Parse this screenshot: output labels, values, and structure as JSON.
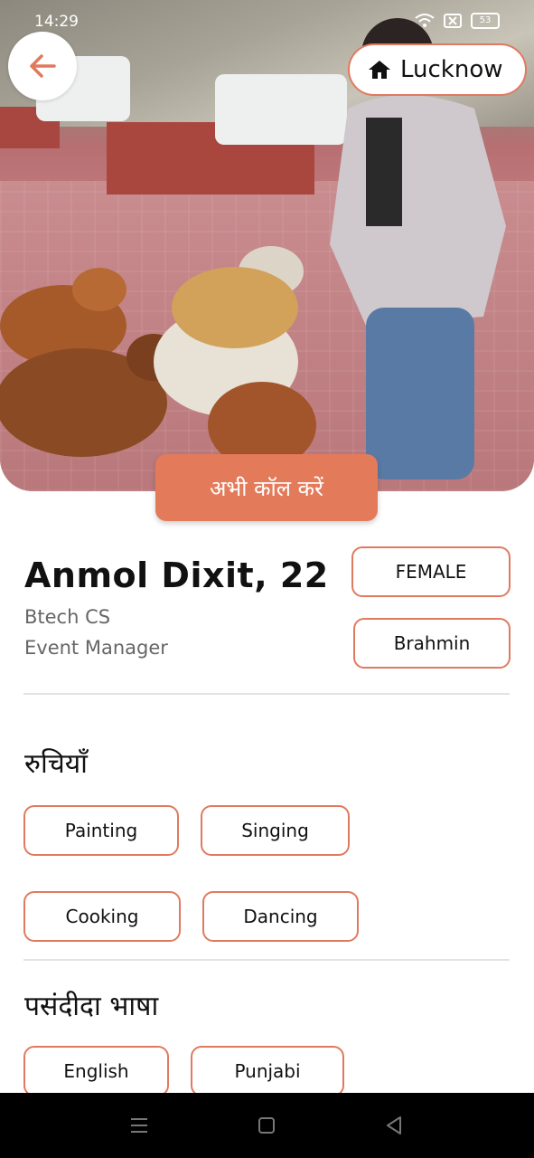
{
  "status_bar": {
    "time": "14:29",
    "battery": "53"
  },
  "header": {
    "location": "Lucknow"
  },
  "call_button": "अभी कॉल करें",
  "profile": {
    "name": "Anmol Dixit, 22",
    "education": "Btech CS",
    "occupation": "Event Manager",
    "gender": "FEMALE",
    "caste": "Brahmin"
  },
  "interests": {
    "title": "रुचियाँ",
    "items": [
      "Painting",
      "Singing",
      "Cooking",
      "Dancing"
    ]
  },
  "languages": {
    "title": "पसंदीदा भाषा",
    "items": [
      "English",
      "Punjabi"
    ]
  },
  "colors": {
    "accent": "#e37b5b",
    "outline": "#e07a5f"
  },
  "icons": {
    "back": "arrow-left-icon",
    "home": "home-icon",
    "nav_menu": "menu-icon",
    "nav_home": "square-icon",
    "nav_back": "triangle-back-icon"
  }
}
